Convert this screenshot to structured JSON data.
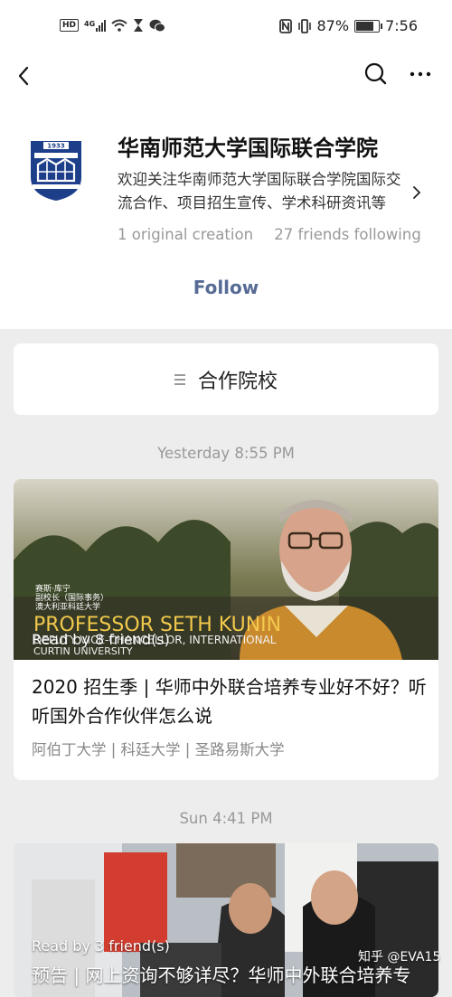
{
  "status_bar": {
    "network_badge": "HD",
    "signal_label": "4G",
    "battery_percent": "87%",
    "battery_level": 0.87,
    "time": "7:56"
  },
  "nav": {
    "back_icon": "chevron-left-icon",
    "search_icon": "search-icon",
    "more_icon": "more-icon"
  },
  "profile": {
    "name": "华南师范大学国际联合学院",
    "description": "欢迎关注华南师范大学国际联合学院国际交流合作、项目招生宣传、学术科研资讯等",
    "original_count": "1 original creation",
    "friends_following": "27 friends following",
    "follow_label": "Follow",
    "logo_year": "1933"
  },
  "menu": {
    "label": "合作院校"
  },
  "articles": [
    {
      "time": "Yesterday 8:55 PM",
      "read_by": "Read by 8 friend(s)",
      "title": "2020 招生季 | 华师中外联合培养专业好不好？听听国外合作伙伴怎么说",
      "subtitle": "阿伯丁大学 | 科廷大学 | 圣路易斯大学",
      "image_text": {
        "cn_caption_1": "赛斯·库宁",
        "cn_caption_2": "副校长（国际事务）",
        "cn_caption_3": "澳大利亚科廷大学",
        "name": "PROFESSOR SETH KUNIN",
        "role": "DEPUTY VICE-CHANCELLOR, INTERNATIONAL",
        "org": "CURTIN UNIVERSITY"
      }
    },
    {
      "time": "Sun 4:41 PM",
      "read_by": "Read by 3 friend(s)",
      "title": "预告 | 网上资询不够详尽？华师中外联合培养专"
    }
  ],
  "watermark": "知乎 @EVA15",
  "colors": {
    "link": "#576b95",
    "background": "#ededed",
    "card": "#ffffff",
    "muted": "#999999"
  }
}
